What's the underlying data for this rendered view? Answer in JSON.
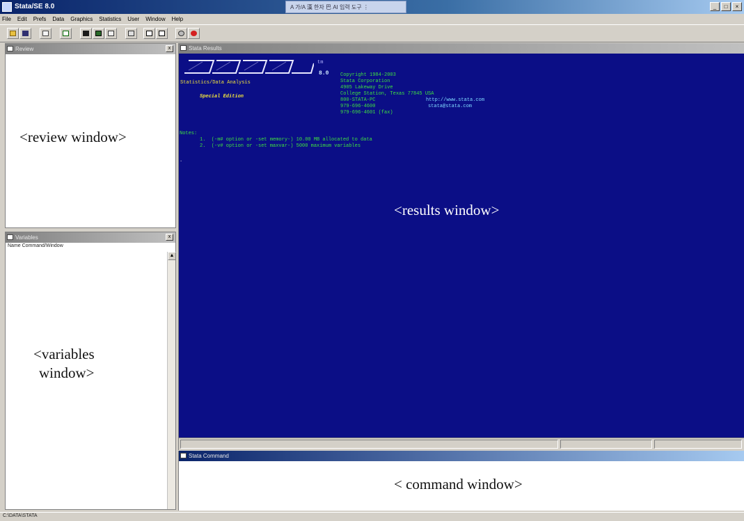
{
  "app": {
    "title": "Stata/SE 8.0",
    "ime_text": "A 가/A 漢 한자 巴 AI 입력 도구 ⋮",
    "window_buttons": [
      "_",
      "□",
      "×"
    ]
  },
  "menu": [
    "File",
    "Edit",
    "Prefs",
    "Data",
    "Graphics",
    "Statistics",
    "User",
    "Window",
    "Help"
  ],
  "toolbar_icons": [
    "open-icon",
    "save-icon",
    "print-icon",
    "log-icon",
    "viewer-icon",
    "graph-icon",
    "do-editor-icon",
    "data-editor-icon",
    "data-browser-icon",
    "varmanager-icon",
    "clear-more-icon",
    "break-icon"
  ],
  "colors": {
    "results_bg": "#0b0e86",
    "title_bar": "#0a246a",
    "break_red": "#d42020"
  },
  "review": {
    "title": "Review",
    "annotation": "<review  window>"
  },
  "variables": {
    "title": "Variables",
    "subtitle": "Name  Command/Window",
    "annotation_line1": "<variables",
    "annotation_line2": "window>"
  },
  "results": {
    "title": "Stata Results",
    "logo_tm": "tm",
    "version": "8.0",
    "edition_line": "Statistics/Data Analysis",
    "special": "Special Edition",
    "copyright": "Copyright 1984-2003",
    "company": "Stata Corporation",
    "address1": "4905 Lakeway Drive",
    "address2": "College Station, Texas 77845 USA",
    "phone1": "800-STATA-PC",
    "url": "http://www.stata.com",
    "phone2": "979-696-4600",
    "email": "stata@stata.com",
    "fax": "979-696-4601 (fax)",
    "notes_label": "Notes:",
    "note1": "1.  (-m# option or -set memory-) 10.00 MB allocated to data",
    "note2": "2.  (-v# option or -set maxvar-) 5000 maximum variables",
    "cursor": ".",
    "annotation": "<results window>"
  },
  "command": {
    "title": "Stata Command",
    "annotation": "< command window>"
  },
  "status_bar": {
    "text": "C:\\DATA\\STATA"
  }
}
